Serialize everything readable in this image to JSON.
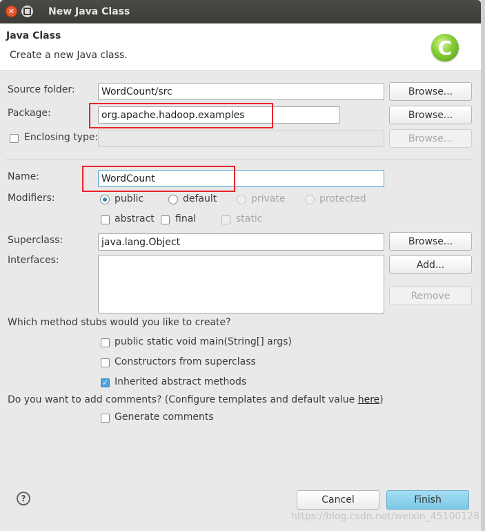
{
  "window": {
    "title": "New Java Class"
  },
  "header": {
    "title": "Java Class",
    "description": "Create a new Java class.",
    "logo_letter": "C"
  },
  "source_folder": {
    "label": "Source folder:",
    "value": "WordCount/src",
    "browse_label": "Browse..."
  },
  "package": {
    "label": "Package:",
    "value": "org.apache.hadoop.examples",
    "browse_label": "Browse..."
  },
  "enclosing_type": {
    "label": "Enclosing type:",
    "value": "",
    "browse_label": "Browse...",
    "checked": false
  },
  "name": {
    "label": "Name:",
    "value": "WordCount"
  },
  "modifiers": {
    "label": "Modifiers:",
    "access": [
      "public",
      "default",
      "private",
      "protected"
    ],
    "selected": "public",
    "other": [
      "abstract",
      "final",
      "static"
    ]
  },
  "superclass": {
    "label": "Superclass:",
    "value": "java.lang.Object",
    "browse_label": "Browse..."
  },
  "interfaces": {
    "label": "Interfaces:",
    "add_label": "Add...",
    "remove_label": "Remove"
  },
  "stubs": {
    "question": "Which method stubs would you like to create?",
    "main": {
      "label": "public static void main(String[] args)",
      "checked": false
    },
    "constructors": {
      "label": "Constructors from superclass",
      "checked": false
    },
    "inherited": {
      "label": "Inherited abstract methods",
      "checked": true
    }
  },
  "comments": {
    "question_prefix": "Do you want to add comments? (Configure templates and default value ",
    "link": "here",
    "question_suffix": ")",
    "generate_label": "Generate comments",
    "checked": false
  },
  "footer": {
    "cancel_label": "Cancel",
    "finish_label": "Finish"
  },
  "watermark": "https://blog.csdn.net/weixin_45100128",
  "colors": {
    "titlebar": "#3c3b37",
    "close": "#e9552a",
    "annotation_box": "#e8232a",
    "finish": "#7cc8e6",
    "check": "#4fa3d8"
  }
}
